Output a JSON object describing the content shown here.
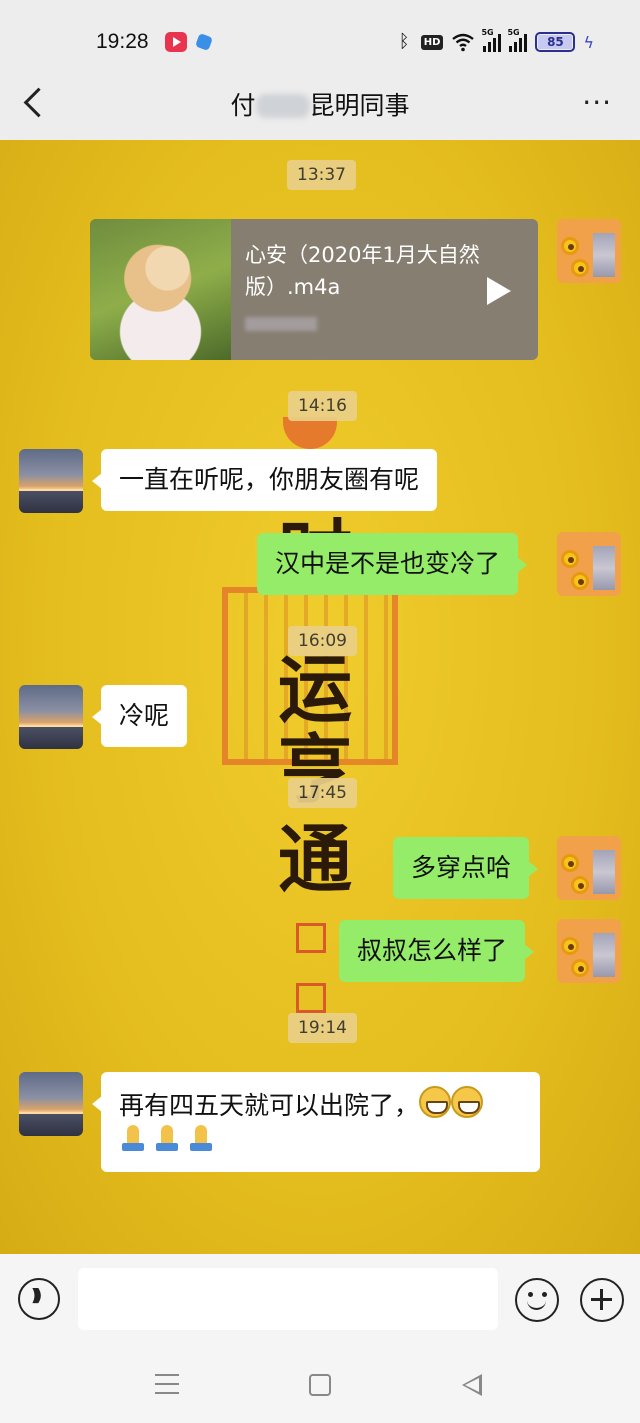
{
  "status_bar": {
    "time": "19:28",
    "hd_label": "HD",
    "signal1_label": "5G",
    "signal2_label": "5G",
    "battery": "85"
  },
  "header": {
    "title_prefix": "付",
    "title_suffix": "昆明同事",
    "more_label": "···"
  },
  "background": {
    "calligraphy_chars": [
      "时",
      "运",
      "亨",
      "通"
    ]
  },
  "messages": {
    "t1": "13:37",
    "audio_title": "心安（2020年1月大自然版）.m4a",
    "t2": "14:16",
    "m1": "一直在听呢，你朋友圈有呢",
    "m2": "汉中是不是也变冷了",
    "t3": "16:09",
    "m3": "冷呢",
    "t4": "17:45",
    "m4": "多穿点哈",
    "m5": "叔叔怎么样了",
    "t5": "19:14",
    "m6": "再有四五天就可以出院了，"
  },
  "input_bar": {
    "placeholder": ""
  },
  "colors": {
    "chat_bg": "#e4bd1e",
    "sent_bubble": "#95ec69",
    "received_bubble": "#ffffff",
    "top_bar": "#ededed"
  }
}
